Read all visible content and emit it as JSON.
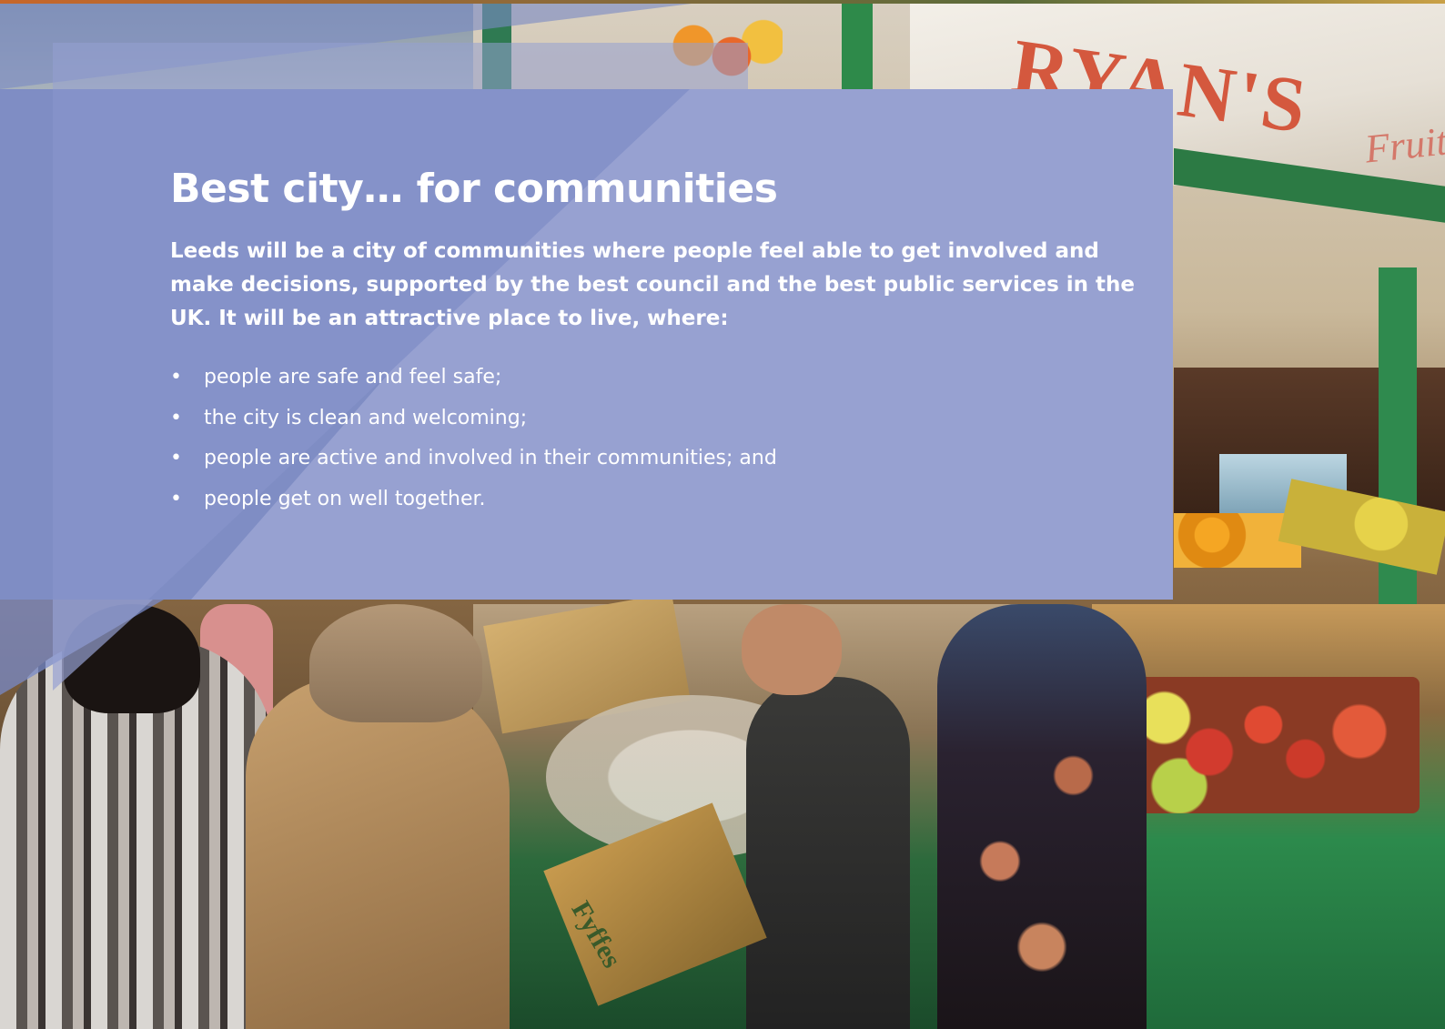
{
  "page": {
    "title": "Best city… for communities",
    "lead": "Leeds will be a city of communities where people feel able to get involved and make decisions, supported by the best council and the best public services in the UK. It will be an attractive place to live, where:",
    "bullet_glyph": "•",
    "bullets": [
      "people are safe and feel safe;",
      "the city is clean and welcoming;",
      "people are active and involved in their communities; and",
      "people get on well together."
    ]
  },
  "photo": {
    "stall_sign": "RYAN'S",
    "stall_sign_sub": "Fruit",
    "box_label": "Fyffes"
  },
  "colors": {
    "panel": "#97a1d1",
    "panel_dark": "#7f8dc4",
    "text": "#ffffff"
  }
}
